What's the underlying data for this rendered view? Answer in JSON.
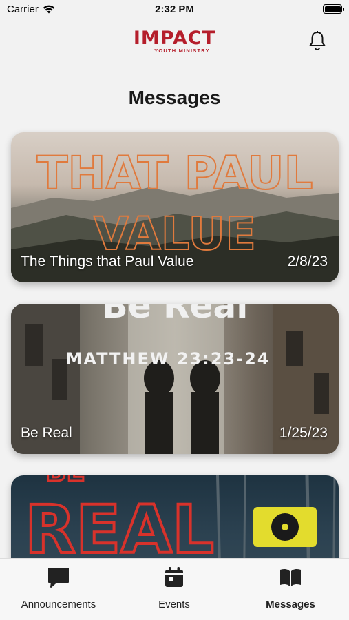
{
  "status_bar": {
    "carrier": "Carrier",
    "time": "2:32 PM"
  },
  "header": {
    "logo_main": "IMPACT",
    "logo_sub": "YOUTH MINISTRY",
    "notifications_icon": "bell-icon",
    "brand_color": "#b51e2b"
  },
  "page": {
    "title": "Messages"
  },
  "messages": [
    {
      "title": "The Things that Paul Value",
      "date": "2/8/23",
      "art_text_1": "THAT PAUL",
      "art_text_2": "VALUE"
    },
    {
      "title": "Be Real",
      "date": "1/25/23",
      "art_text_1": "MATTHEW 23:23-24",
      "art_text_top": "Be Real"
    },
    {
      "art_text_1": "REAL",
      "art_text_top": "BE"
    }
  ],
  "tab_bar": {
    "tabs": [
      {
        "label": "Announcements",
        "icon": "chat-bubble-icon",
        "active": false
      },
      {
        "label": "Events",
        "icon": "calendar-icon",
        "active": false
      },
      {
        "label": "Messages",
        "icon": "book-icon",
        "active": true
      }
    ]
  }
}
